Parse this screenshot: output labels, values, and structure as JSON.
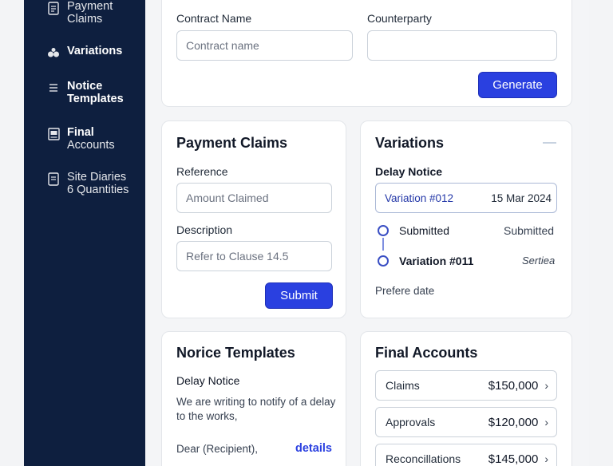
{
  "sidebar": {
    "items": [
      {
        "line1": "Payment",
        "line2": "Claims",
        "icon": "document-icon"
      },
      {
        "line1": "Variations",
        "line2": "",
        "icon": "circles-icon"
      },
      {
        "line1": "Notice",
        "line2": "Templates",
        "icon": "list-icon"
      },
      {
        "line1": "Final",
        "line2": "Accounts",
        "icon": "ledger-icon"
      },
      {
        "line1": "Site Diaries",
        "line2": "6 Quantities",
        "icon": "diary-icon"
      }
    ]
  },
  "generator": {
    "contract_label": "Contract Name",
    "contract_placeholder": "Contract name",
    "counterparty_label": "Counterparty",
    "counterparty_value": "",
    "generate_label": "Generate"
  },
  "payment_claims": {
    "title": "Payment Claims",
    "reference_label": "Reference",
    "reference_placeholder": "Amount Claimed",
    "description_label": "Description",
    "description_placeholder": "Refer to Clause 14.5",
    "submit_label": "Submit"
  },
  "variations": {
    "title": "Variations",
    "subtitle": "Delay Notice",
    "selected_variation": "Variation #012",
    "selected_date": "15 Mar 2024",
    "timeline": [
      {
        "label": "Submitted",
        "status": "Submitted"
      },
      {
        "label": "Variation #011",
        "status": "Sertiea"
      }
    ],
    "footer": "Prefere date"
  },
  "notice_templates": {
    "title": "Norice Templates",
    "subtitle": "Delay Notice",
    "body_line1": "We are writing to notify of a delay",
    "body_line2": "to the works,",
    "salutation": "Dear (Recipient),",
    "details_link": "details"
  },
  "final_accounts": {
    "title": "Final Accounts",
    "rows": [
      {
        "label": "Claims",
        "value": "$150,000"
      },
      {
        "label": "Approvals",
        "value": "$120,000"
      },
      {
        "label": "Reconcillations",
        "value": "$145,000"
      }
    ]
  },
  "colors": {
    "sidebar_bg": "#0e1f3f",
    "accent": "#2a40e0",
    "link": "#2a40e0"
  }
}
